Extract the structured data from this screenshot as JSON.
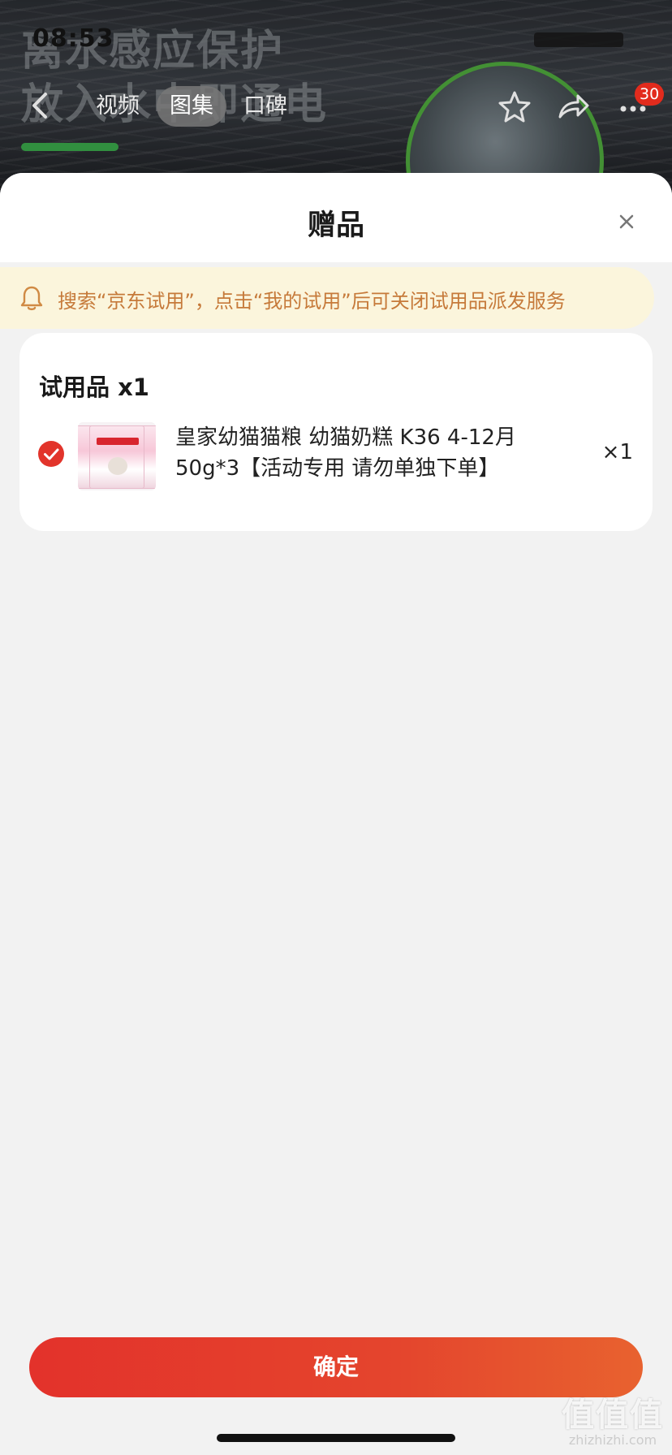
{
  "status_bar": {
    "time": "08:53"
  },
  "background": {
    "promo_line1": "离水感应保护",
    "promo_line2": "放入水中即通电"
  },
  "topnav": {
    "tabs": [
      {
        "label": "视频",
        "active": false
      },
      {
        "label": "图集",
        "active": true
      },
      {
        "label": "口碑",
        "active": false
      }
    ],
    "badge_count": "30",
    "icons": [
      "back-icon",
      "star-icon",
      "share-icon",
      "more-icon"
    ]
  },
  "sheet": {
    "title": "赠品",
    "notice": "搜索“京东试用”，点击“我的试用”后可关闭试用品派发服务",
    "section": {
      "title": "试用品 x1",
      "items": [
        {
          "name": "皇家幼猫猫粮 幼猫奶糕 K36  4-12月 50g*3【活动专用 请勿单独下单】",
          "qty": "×1",
          "checked": true
        }
      ]
    },
    "confirm_label": "确定"
  },
  "watermark": {
    "big": "值值值",
    "small": "zhizhizhi.com"
  },
  "colors": {
    "accent": "#e3322b",
    "notice_bg": "#fbf5dc",
    "notice_text": "#c67a3a",
    "badge": "#e22b1d"
  }
}
